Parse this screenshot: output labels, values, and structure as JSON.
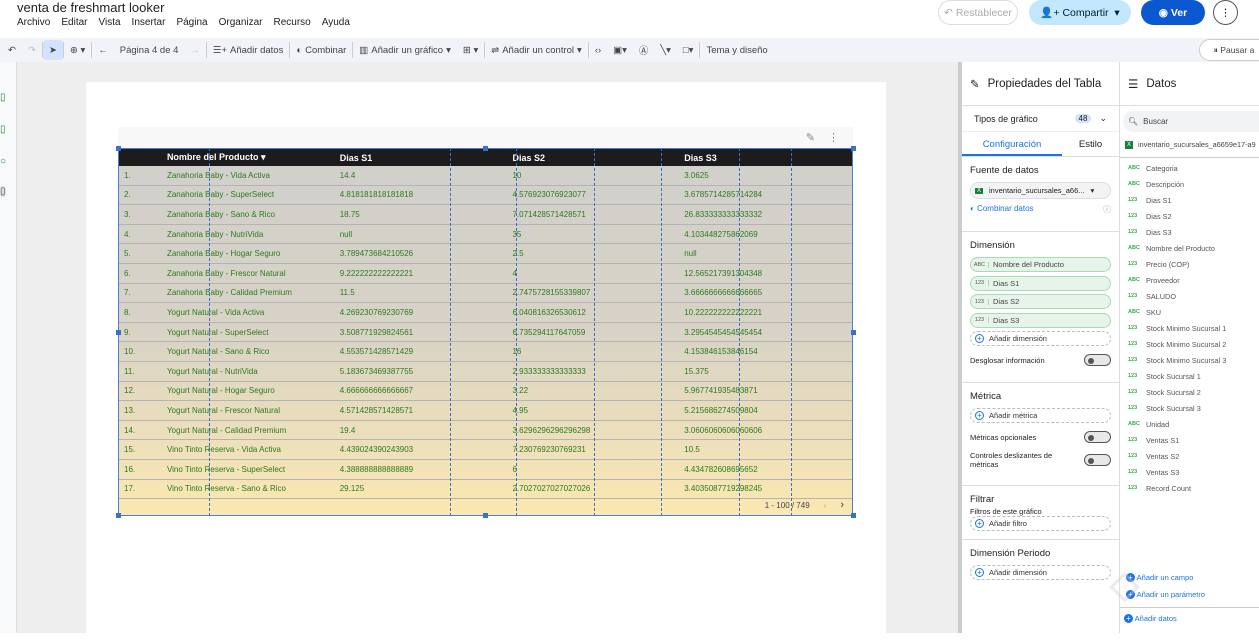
{
  "app": {
    "title": "venta de freshmart looker",
    "menu": [
      "Archivo",
      "Editar",
      "Vista",
      "Insertar",
      "Página",
      "Organizar",
      "Recurso",
      "Ayuda"
    ],
    "reset": "Restablecer",
    "share": "Compartir",
    "view": "Ver",
    "pause": "Pausar a"
  },
  "toolbar": {
    "page": "Página 4 de 4",
    "add_data": "Añadir datos",
    "blend": "Combinar",
    "add_chart": "Añadir un gráfico",
    "add_control": "Añadir un control",
    "theme": "Tema y diseño"
  },
  "table": {
    "headers": [
      "Nombre del Producto",
      "Dias S1",
      "Dias S2",
      "Dias S3"
    ],
    "rows": [
      [
        "1.",
        "Zanahoria Baby - Vida Activa",
        "14.4",
        "10",
        "3.0625"
      ],
      [
        "2.",
        "Zanahoria Baby - SuperSelect",
        "4.818181818181818",
        "4.576923076923077",
        "3.6785714285714284"
      ],
      [
        "3.",
        "Zanahoria Baby - Sano & Rico",
        "18.75",
        "7.071428571428571",
        "26.833333333333332"
      ],
      [
        "4.",
        "Zanahoria Baby - NutriVida",
        "null",
        "35",
        "4.103448275862069"
      ],
      [
        "5.",
        "Zanahoria Baby - Hogar Seguro",
        "3.789473684210526",
        "2.5",
        "null"
      ],
      [
        "6.",
        "Zanahoria Baby - Frescor Natural",
        "9.222222222222221",
        "4",
        "12.565217391304348"
      ],
      [
        "7.",
        "Zanahoria Baby - Calidad Premium",
        "11.5",
        "2.7475728155339807",
        "3.6666666666666665"
      ],
      [
        "8.",
        "Yogurt Natural - Vida Activa",
        "4.269230769230769",
        "6.040816326530612",
        "10.222222222222221"
      ],
      [
        "9.",
        "Yogurt Natural - SuperSelect",
        "3.508771929824561",
        "6.735294117647059",
        "3.2954545454545454"
      ],
      [
        "10.",
        "Yogurt Natural - Sano & Rico",
        "4.553571428571429",
        "16",
        "4.153846153846154"
      ],
      [
        "11.",
        "Yogurt Natural - NutriVida",
        "5.183673469387755",
        "2.933333333333333",
        "15.375"
      ],
      [
        "12.",
        "Yogurt Natural - Hogar Seguro",
        "4.666666666666667",
        "3.22",
        "5.967741935483871"
      ],
      [
        "13.",
        "Yogurt Natural - Frescor Natural",
        "4.571428571428571",
        "4.95",
        "5.215686274509804"
      ],
      [
        "14.",
        "Yogurt Natural - Calidad Premium",
        "19.4",
        "3.6296296296296298",
        "3.0606060606060606"
      ],
      [
        "15.",
        "Vino Tinto Reserva - Vida Activa",
        "4.439024390243903",
        "7.230769230769231",
        "10.5"
      ],
      [
        "16.",
        "Vino Tinto Reserva - SuperSelect",
        "4.388888888888889",
        "6",
        "4.434782608695652"
      ],
      [
        "17.",
        "Vino Tinto Reserva - Sano & Rico",
        "29.125",
        "2.7027027027027026",
        "3.4035087719298245"
      ]
    ],
    "pagination": "1 - 100 / 749"
  },
  "props": {
    "title": "Propiedades del Tabla",
    "chart_types": "Tipos de gráfico",
    "chart_count": "48",
    "tab_config": "Configuración",
    "tab_style": "Estilo",
    "source_label": "Fuente de datos",
    "source": "inventario_sucursales_a66...",
    "blend": "Combinar datos",
    "dimension": "Dimensión",
    "dims": [
      {
        "t": "ABC",
        "n": "Nombre del Producto"
      },
      {
        "t": "123",
        "n": "Dias S1"
      },
      {
        "t": "123",
        "n": "Dias S2"
      },
      {
        "t": "123",
        "n": "Dias S3"
      }
    ],
    "add_dimension": "Añadir dimensión",
    "drill": "Desglosar información",
    "metric": "Métrica",
    "add_metric": "Añadir métrica",
    "optional_metrics": "Métricas opcionales",
    "sliders": "Controles deslizantes de métricas",
    "filter": "Filtrar",
    "chart_filters": "Filtros de este gráfico",
    "add_filter": "Añadir filtro",
    "period": "Dimensión Periodo",
    "add_period": "Añadir dimensión"
  },
  "datos": {
    "title": "Datos",
    "search": "Buscar",
    "source": "inventario_sucursales_a6659e17-a9",
    "fields": [
      {
        "t": "ABC",
        "n": "Categoria"
      },
      {
        "t": "ABC",
        "n": "Descripción"
      },
      {
        "t": "123",
        "n": "Dias S1"
      },
      {
        "t": "123",
        "n": "Dias S2"
      },
      {
        "t": "123",
        "n": "Dias S3"
      },
      {
        "t": "ABC",
        "n": "Nombre del Producto"
      },
      {
        "t": "123",
        "n": "Precio (COP)"
      },
      {
        "t": "ABC",
        "n": "Proveedor"
      },
      {
        "t": "123",
        "n": "SALUDO"
      },
      {
        "t": "ABC",
        "n": "SKU"
      },
      {
        "t": "123",
        "n": "Stock Minimo Sucursal 1"
      },
      {
        "t": "123",
        "n": "Stock Minimo Sucursal 2"
      },
      {
        "t": "123",
        "n": "Stock Minimo Sucursal 3"
      },
      {
        "t": "123",
        "n": "Stock Sucursal 1"
      },
      {
        "t": "123",
        "n": "Stock Sucursal 2"
      },
      {
        "t": "123",
        "n": "Stock Sucursal 3"
      },
      {
        "t": "ABC",
        "n": "Unidad"
      },
      {
        "t": "123",
        "n": "Ventas S1"
      },
      {
        "t": "123",
        "n": "Ventas S2"
      },
      {
        "t": "123",
        "n": "Ventas S3"
      },
      {
        "t": "123",
        "n": "Record Count"
      }
    ],
    "add_field": "Añadir un campo",
    "add_param": "Añadir un parámetro",
    "add_data": "Añadir datos"
  },
  "watermark": "Platzi"
}
